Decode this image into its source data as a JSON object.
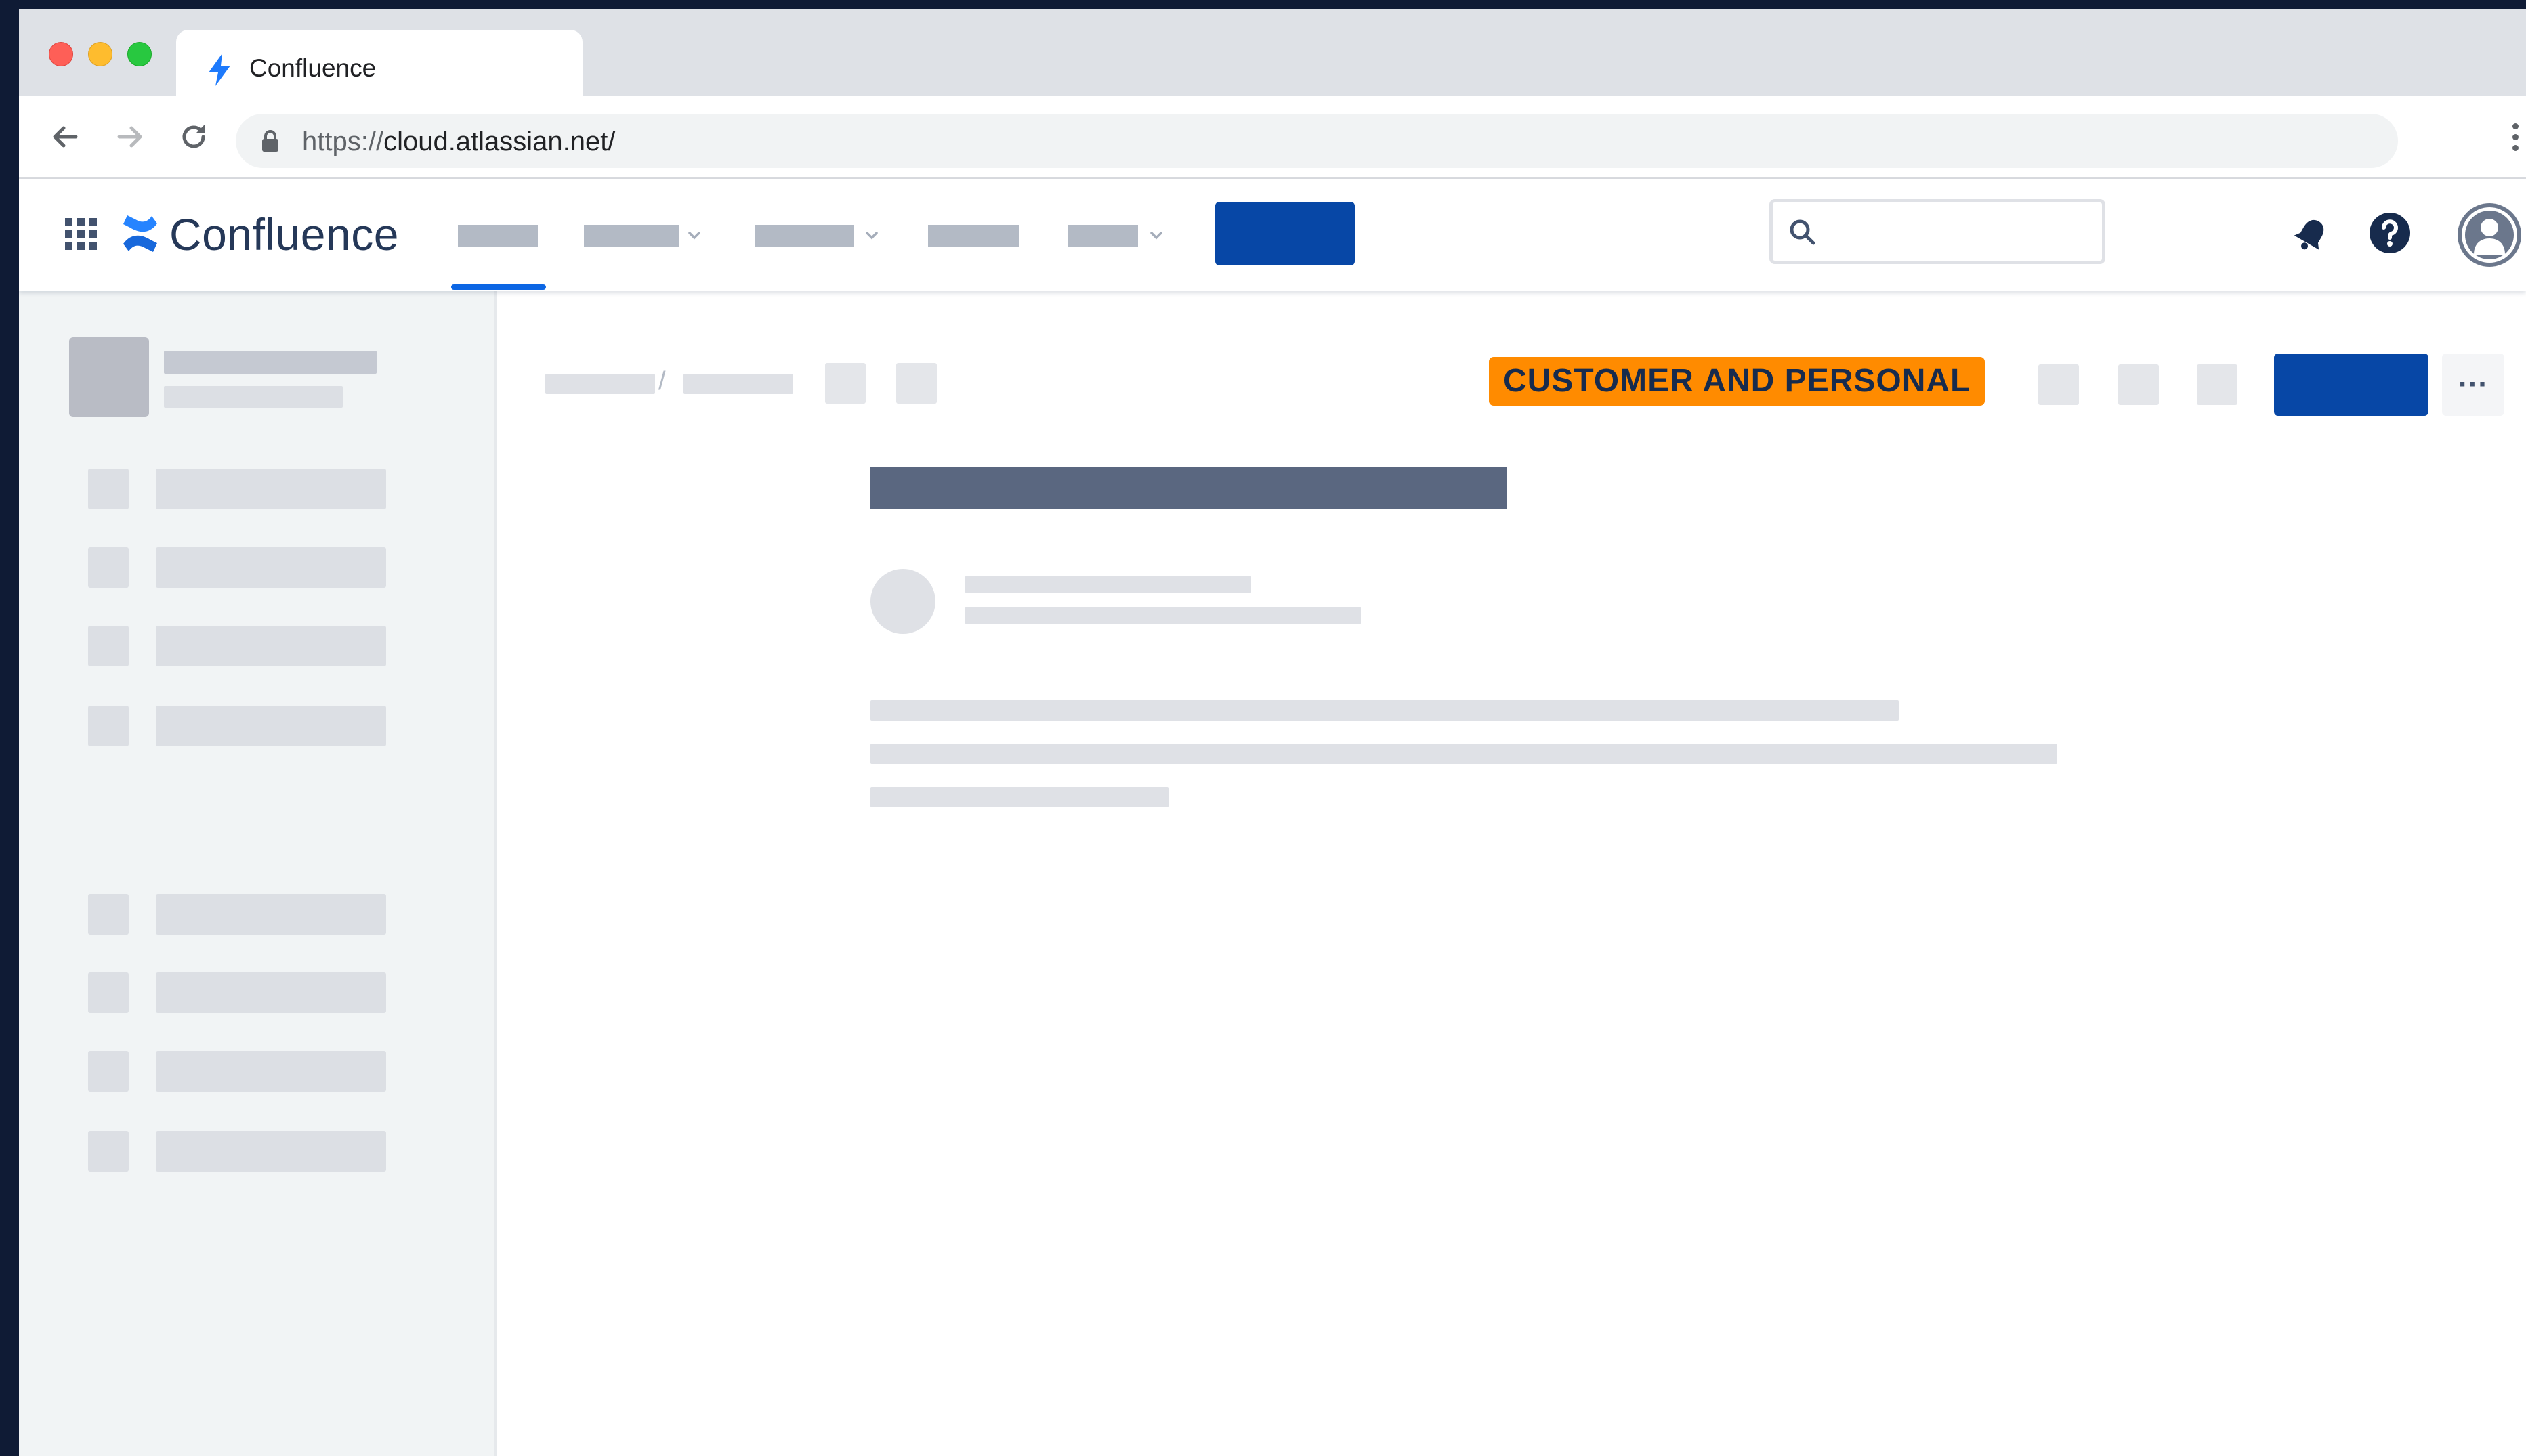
{
  "browser": {
    "tab_title": "Confluence",
    "url_scheme": "https://",
    "url_host": "cloud.atlassian.net/"
  },
  "app": {
    "product_name": "Confluence",
    "brand_color": "#0c66e4"
  },
  "header": {
    "nav_items": [
      {
        "name": "nav-item-1",
        "has_dropdown": false,
        "active": true
      },
      {
        "name": "nav-item-2",
        "has_dropdown": true,
        "active": false
      },
      {
        "name": "nav-item-3",
        "has_dropdown": true,
        "active": false
      },
      {
        "name": "nav-item-4",
        "has_dropdown": false,
        "active": false
      },
      {
        "name": "nav-item-5",
        "has_dropdown": true,
        "active": false
      }
    ],
    "create_button_color": "#0747a6",
    "search_placeholder": ""
  },
  "page": {
    "classification_label": "CUSTOMER AND PERSONAL",
    "classification_color": "#ff8b00",
    "more_actions_label": "···"
  }
}
